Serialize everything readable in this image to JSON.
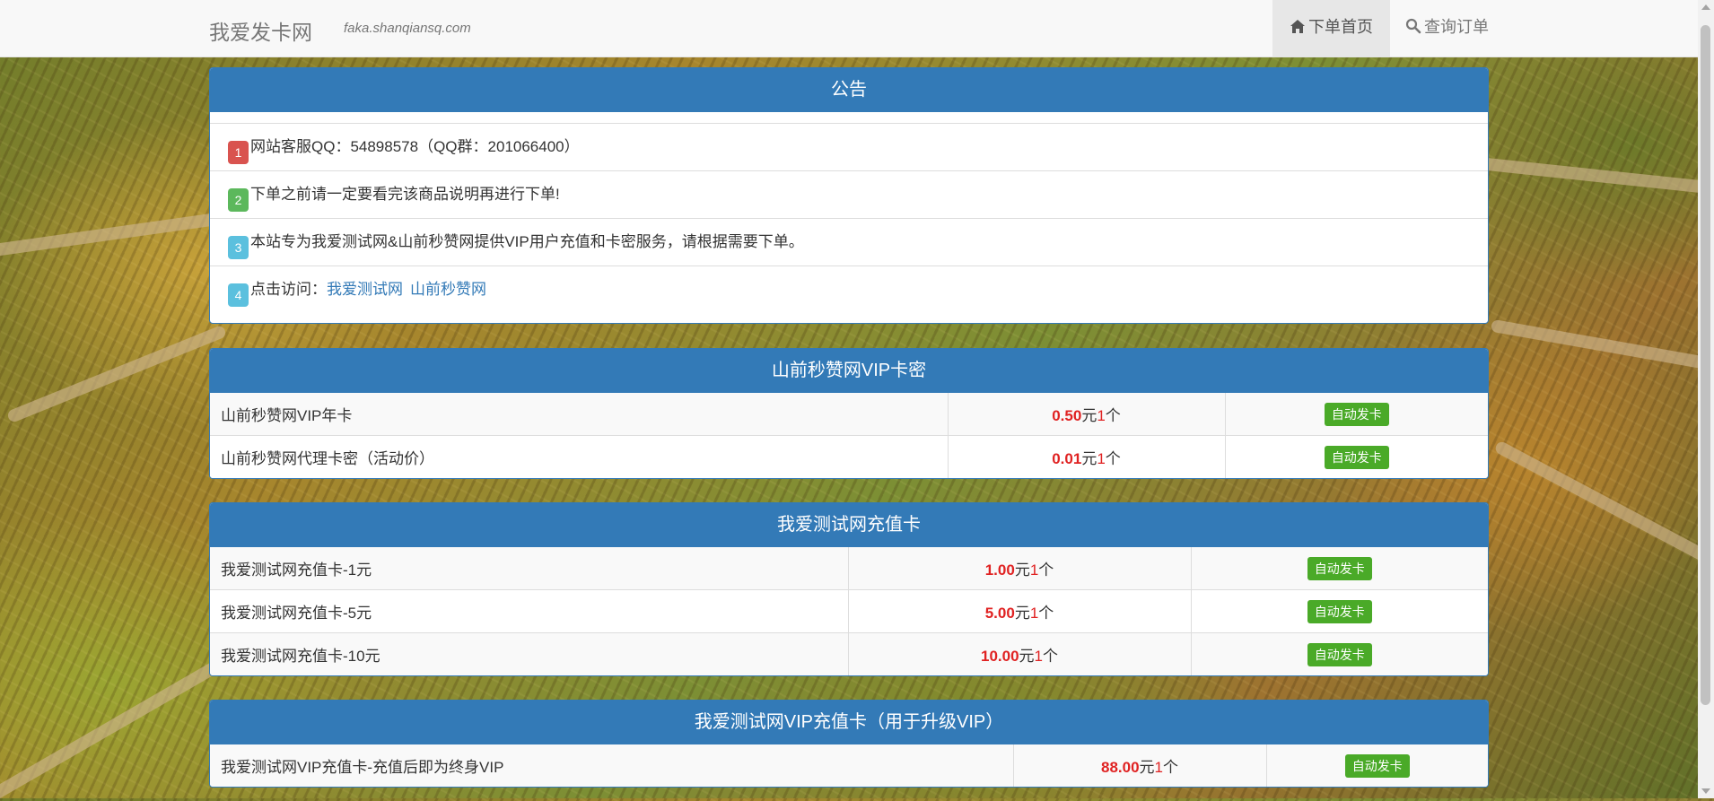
{
  "navbar": {
    "brand": "我爱发卡网",
    "domain": "faka.shanqiansq.com",
    "links": [
      {
        "label": "下单首页",
        "icon": "home-icon",
        "active": true
      },
      {
        "label": "查询订单",
        "icon": "search-icon",
        "active": false
      }
    ]
  },
  "notice": {
    "title": "公告",
    "items": [
      {
        "num": "1",
        "color": "#d9534f",
        "text": "网站客服QQ：54898578（QQ群：201066400）"
      },
      {
        "num": "2",
        "color": "#5cb85c",
        "text": "下单之前请一定要看完该商品说明再进行下单!"
      },
      {
        "num": "3",
        "color": "#5bc0de",
        "text": "本站专为我爱测试网&山前秒赞网提供VIP用户充值和卡密服务，请根据需要下单。"
      },
      {
        "num": "4",
        "color": "#5bc0de",
        "text": "点击访问：",
        "links": [
          "我爱测试网",
          "山前秒赞网"
        ]
      }
    ]
  },
  "categories": [
    {
      "title": "山前秒赞网VIP卡密",
      "products": [
        {
          "name": "山前秒赞网VIP年卡",
          "price": "0.50",
          "unit": "元",
          "qty": "1",
          "qty_unit": "个",
          "button": "自动发卡"
        },
        {
          "name": "山前秒赞网代理卡密（活动价）",
          "price": "0.01",
          "unit": "元",
          "qty": "1",
          "qty_unit": "个",
          "button": "自动发卡"
        }
      ]
    },
    {
      "title": "我爱测试网充值卡",
      "products": [
        {
          "name": "我爱测试网充值卡-1元",
          "price": "1.00",
          "unit": "元",
          "qty": "1",
          "qty_unit": "个",
          "button": "自动发卡"
        },
        {
          "name": "我爱测试网充值卡-5元",
          "price": "5.00",
          "unit": "元",
          "qty": "1",
          "qty_unit": "个",
          "button": "自动发卡"
        },
        {
          "name": "我爱测试网充值卡-10元",
          "price": "10.00",
          "unit": "元",
          "qty": "1",
          "qty_unit": "个",
          "button": "自动发卡"
        }
      ]
    },
    {
      "title": "我爱测试网VIP充值卡（用于升级VIP）",
      "products": [
        {
          "name": "我爱测试网VIP充值卡-充值后即为终身VIP",
          "price": "88.00",
          "unit": "元",
          "qty": "1",
          "qty_unit": "个",
          "button": "自动发卡"
        }
      ]
    }
  ],
  "colors": {
    "primary": "#337ab7",
    "price": "#e02222",
    "button": "#4aaa28"
  }
}
